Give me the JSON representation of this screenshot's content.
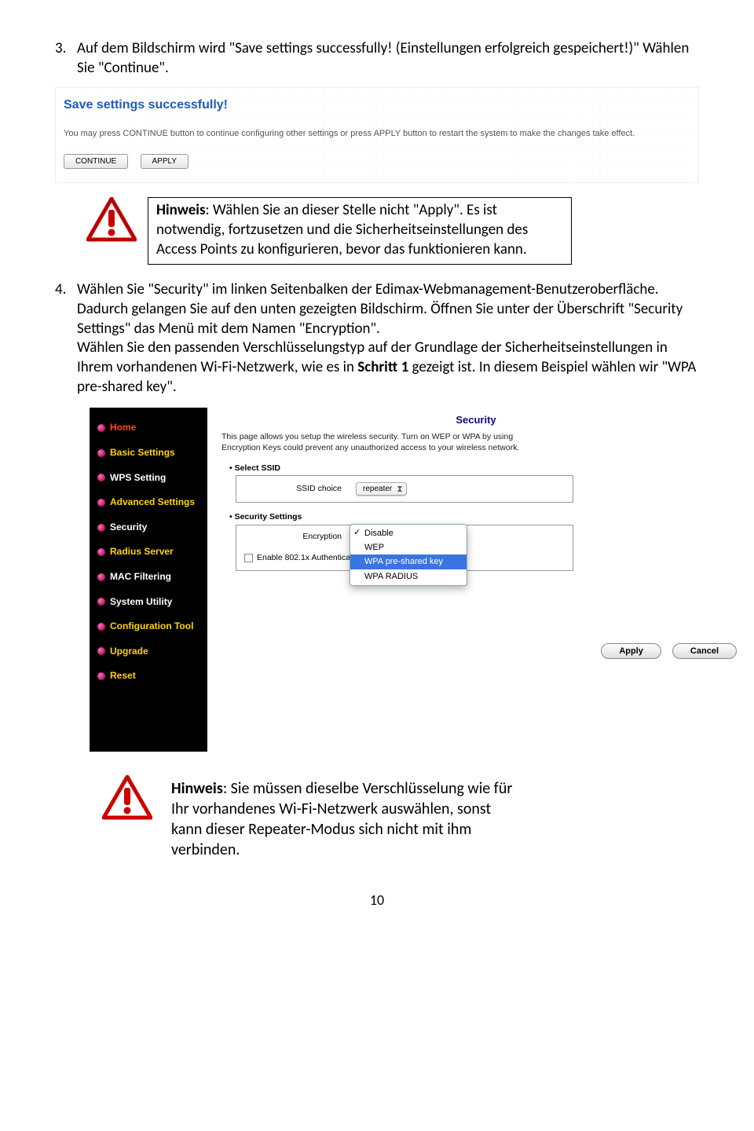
{
  "step3": {
    "num": "3.",
    "text": "Auf dem Bildschirm wird \"Save settings successfully! (Einstellungen erfolgreich gespeichert!)\" Wählen Sie \"Continue\"."
  },
  "screenshot1": {
    "title": "Save settings successfully!",
    "text": "You may press CONTINUE button to continue configuring other settings or press APPLY button to restart the system to make the changes take effect.",
    "btn_continue": "CONTINUE",
    "btn_apply": "APPLY"
  },
  "hinweis1": {
    "label": "Hinweis",
    "text": ": Wählen Sie an dieser Stelle nicht \"Apply\". Es ist notwendig, fortzusetzen und die Sicherheitseinstellungen des Access Points zu konfigurieren, bevor das funktionieren kann."
  },
  "step4": {
    "num": "4.",
    "text_a": "Wählen Sie \"Security\" im linken Seitenbalken der Edimax-Webmanagement-Benutzeroberfläche. Dadurch gelangen Sie auf den unten gezeigten Bildschirm. Öffnen Sie unter der Überschrift \"Security Settings\" das Menü mit dem Namen \"Encryption\".",
    "text_b": "Wählen Sie den passenden Verschlüsselungstyp auf der Grundlage der Sicherheitseinstellungen in Ihrem vorhandenen Wi-Fi-Netzwerk, wie es in ",
    "schritt": "Schritt 1",
    "text_c": " gezeigt ist. In diesem Beispiel wählen wir \"WPA pre-shared key\"."
  },
  "sidebar": {
    "items": [
      {
        "label": "Home",
        "cls": "home"
      },
      {
        "label": "Basic Settings",
        "cls": "yellow"
      },
      {
        "label": "WPS Setting",
        "cls": "white"
      },
      {
        "label": "Advanced Settings",
        "cls": "yellow"
      },
      {
        "label": "Security",
        "cls": "white"
      },
      {
        "label": "Radius Server",
        "cls": "yellow"
      },
      {
        "label": "MAC Filtering",
        "cls": "white"
      },
      {
        "label": "System Utility",
        "cls": "white"
      },
      {
        "label": "Configuration Tool",
        "cls": "yellow"
      },
      {
        "label": "Upgrade",
        "cls": "yellow"
      },
      {
        "label": "Reset",
        "cls": "yellow"
      }
    ]
  },
  "security_panel": {
    "title": "Security",
    "desc": "This page allows you setup the wireless security. Turn on WEP or WPA by using Encryption Keys could prevent any unauthorized access to your wireless network.",
    "select_ssid": "Select SSID",
    "ssid_choice": "SSID choice",
    "ssid_value": "repeater",
    "sec_settings": "Security Settings",
    "encryption": "Encryption",
    "enable_auth": "Enable 802.1x Authentica",
    "options": [
      "Disable",
      "WEP",
      "WPA pre-shared key",
      "WPA RADIUS"
    ],
    "checked_index": 0,
    "selected_index": 2,
    "btn_apply": "Apply",
    "btn_cancel": "Cancel"
  },
  "hinweis2": {
    "label": "Hinweis",
    "text": ": Sie müssen dieselbe Verschlüsselung wie für Ihr vorhandenes Wi-Fi-Netzwerk auswählen, sonst kann dieser Repeater-Modus sich nicht mit ihm verbinden."
  },
  "page_num": "10"
}
